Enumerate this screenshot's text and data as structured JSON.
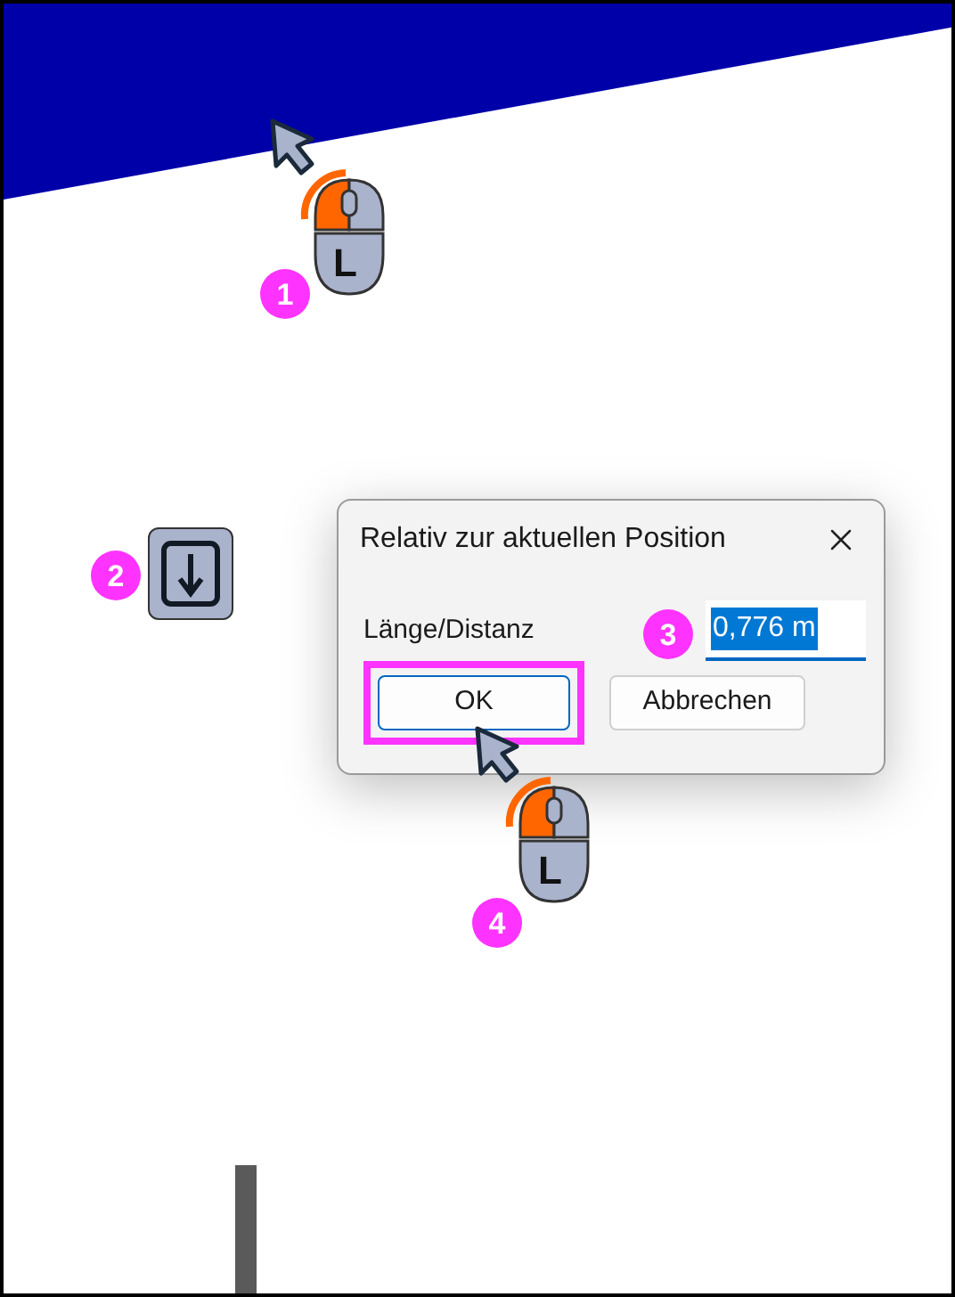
{
  "markers": [
    {
      "number": "1"
    },
    {
      "number": "2"
    },
    {
      "number": "3"
    },
    {
      "number": "4"
    }
  ],
  "mice": [
    {
      "key": "L",
      "left_pressed": true
    },
    {
      "key": "L",
      "left_pressed": true
    }
  ],
  "dialog": {
    "title": "Relativ zur aktuellen Position",
    "field": {
      "label": "Länge/Distanz",
      "value": "0,776 m",
      "selected": true
    },
    "buttons": [
      {
        "label": "OK",
        "highlighted": true
      },
      {
        "label": "Abbrechen",
        "highlighted": false
      }
    ]
  }
}
